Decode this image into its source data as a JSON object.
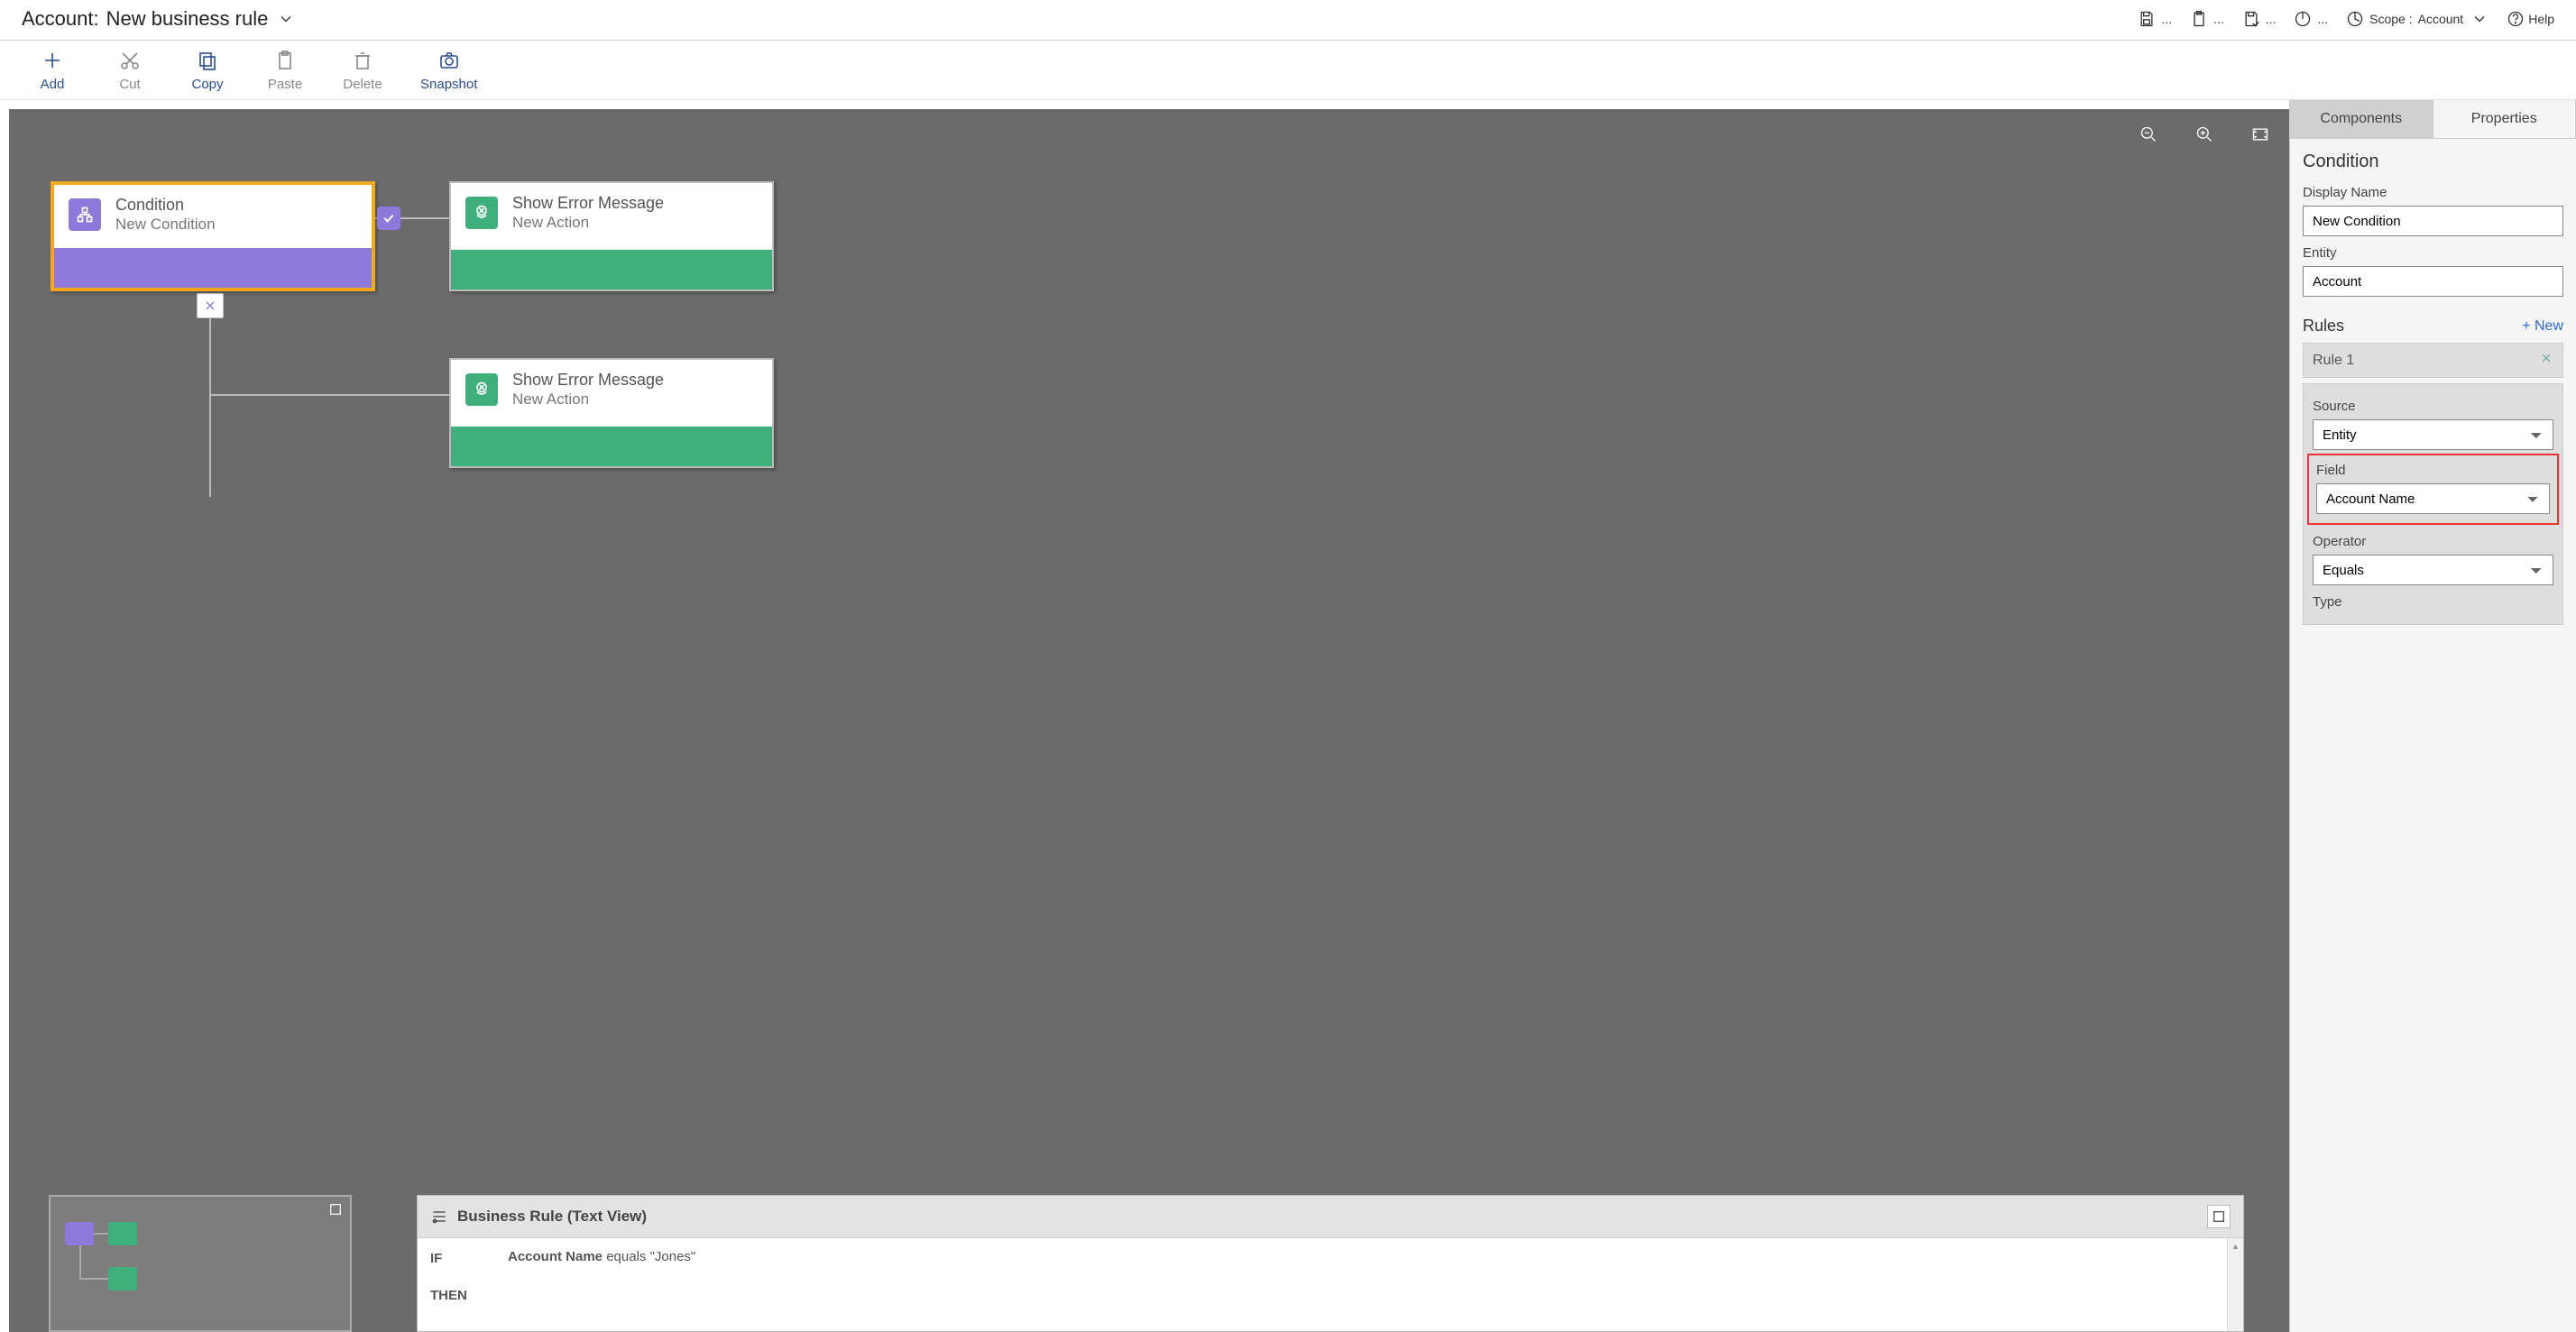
{
  "header": {
    "title_prefix": "Account:",
    "title_name": "New business rule",
    "scope_label": "Scope :",
    "scope_value": "Account",
    "help_label": "Help"
  },
  "toolbar": {
    "add": "Add",
    "cut": "Cut",
    "copy": "Copy",
    "paste": "Paste",
    "delete": "Delete",
    "snapshot": "Snapshot"
  },
  "nodes": {
    "condition": {
      "title": "Condition",
      "subtitle": "New Condition"
    },
    "action1": {
      "title": "Show Error Message",
      "subtitle": "New Action"
    },
    "action2": {
      "title": "Show Error Message",
      "subtitle": "New Action"
    }
  },
  "textview": {
    "title": "Business Rule (Text View)",
    "if_label": "IF",
    "then_label": "THEN",
    "if_text_bold": "Account Name",
    "if_text_rest": " equals \"Jones\""
  },
  "properties": {
    "tab_components": "Components",
    "tab_properties": "Properties",
    "section_title": "Condition",
    "display_name_label": "Display Name",
    "display_name_value": "New Condition",
    "entity_label": "Entity",
    "entity_value": "Account",
    "rules_label": "Rules",
    "new_label": "+  New",
    "rule1_label": "Rule 1",
    "source_label": "Source",
    "source_value": "Entity",
    "field_label": "Field",
    "field_value": "Account Name",
    "operator_label": "Operator",
    "operator_value": "Equals",
    "type_label": "Type"
  }
}
